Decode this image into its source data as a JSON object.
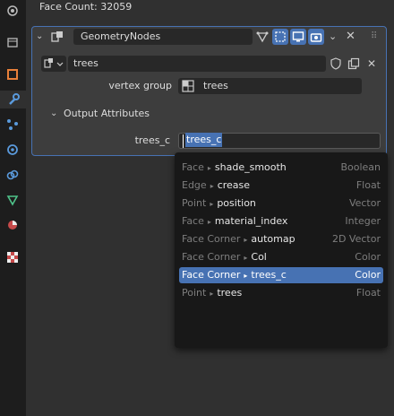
{
  "header": {
    "face_count": "Face Count: 32059"
  },
  "modifier": {
    "name": "GeometryNodes",
    "node_group": "trees",
    "vertex_group_label": "vertex group",
    "vertex_group_value": "trees",
    "output_section": "Output Attributes",
    "output_label": "trees_c",
    "output_value": "trees_c"
  },
  "dropdown": {
    "items": [
      {
        "domain": "Face",
        "name": "shade_smooth",
        "type": "Boolean",
        "selected": false
      },
      {
        "domain": "Edge",
        "name": "crease",
        "type": "Float",
        "selected": false
      },
      {
        "domain": "Point",
        "name": "position",
        "type": "Vector",
        "selected": false
      },
      {
        "domain": "Face",
        "name": "material_index",
        "type": "Integer",
        "selected": false
      },
      {
        "domain": "Face Corner",
        "name": "automap",
        "type": "2D Vector",
        "selected": false
      },
      {
        "domain": "Face Corner",
        "name": "Col",
        "type": "Color",
        "selected": false
      },
      {
        "domain": "Face Corner",
        "name": "trees_c",
        "type": "Color",
        "selected": true
      },
      {
        "domain": "Point",
        "name": "trees",
        "type": "Float",
        "selected": false
      }
    ]
  },
  "colors": {
    "accent": "#4772b3",
    "panel": "#3d3d3d",
    "background": "#303030",
    "menu": "#181818"
  }
}
